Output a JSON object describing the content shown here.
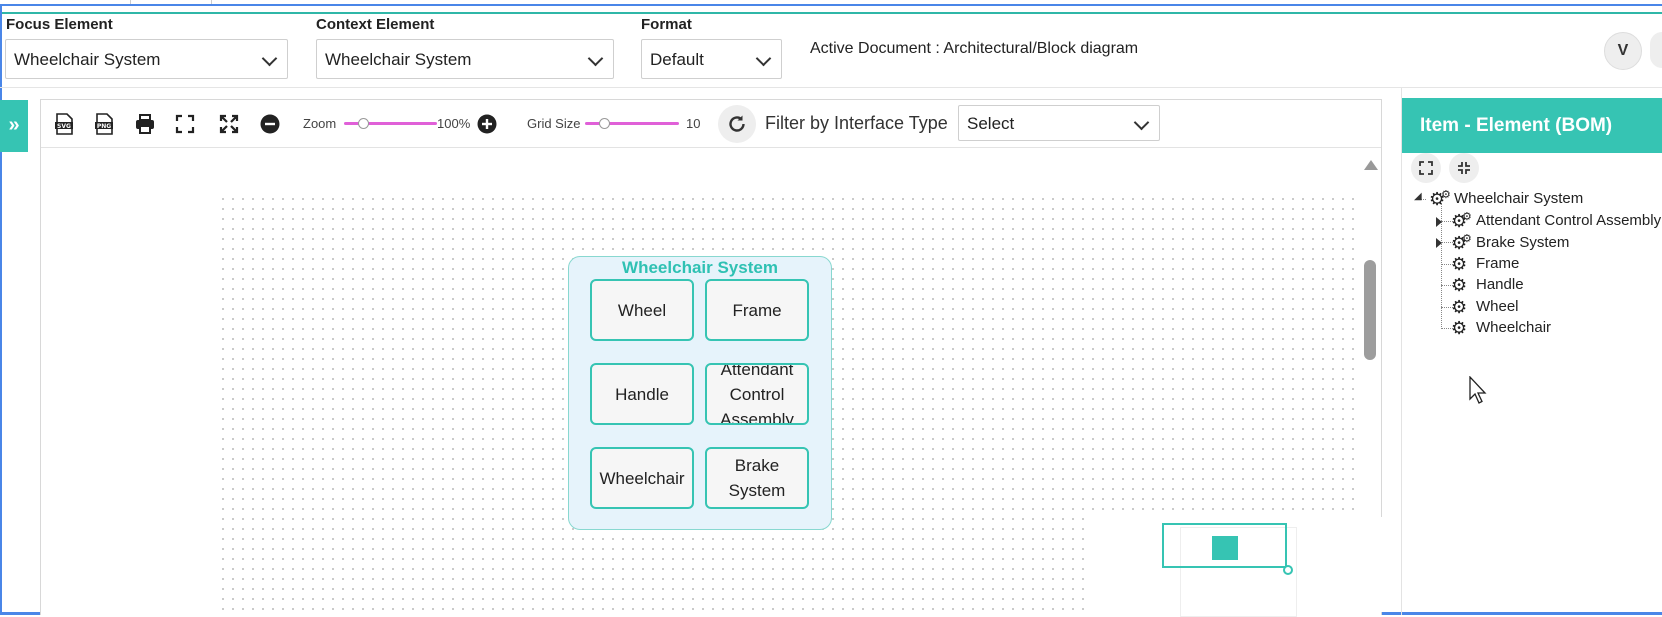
{
  "header": {
    "focus_label": "Focus Element",
    "focus_value": "Wheelchair System",
    "context_label": "Context Element",
    "context_value": "Wheelchair System",
    "format_label": "Format",
    "format_value": "Default",
    "active_document": "Active Document : Architectural/Block diagram",
    "user_icon_text": "V"
  },
  "toolbar": {
    "svg_label": "SVG",
    "png_label": "PNG",
    "zoom_label": "Zoom",
    "zoom_value": "100%",
    "zoom_level": 0.2,
    "grid_label": "Grid Size",
    "grid_value": "10",
    "grid_level": 0.2,
    "filter_label": "Filter by Interface Type",
    "filter_value": "Select"
  },
  "diagram": {
    "system_title": "Wheelchair System",
    "nodes": [
      "Wheel",
      "Frame",
      "Handle",
      "Attendant Control Assembly",
      "Wheelchair",
      "Brake System"
    ]
  },
  "right_panel": {
    "title": "Item - Element (BOM)",
    "tree": {
      "root": "Wheelchair System",
      "children": [
        "Attendant Control Assembly",
        "Brake System",
        "Frame",
        "Handle",
        "Wheel",
        "Wheelchair"
      ]
    }
  },
  "colors": {
    "accent": "#36c4b3",
    "slider": "#e060d8",
    "container_bg": "#e6f3fb",
    "frame_blue": "#4a86e8"
  },
  "icons": [
    "svg-export-icon",
    "png-export-icon",
    "print-icon",
    "fit-screen-icon",
    "expand-icon",
    "zoom-out-icon",
    "zoom-in-icon",
    "refresh-icon",
    "gear-icon",
    "chevron-down-icon",
    "double-chevron-right-icon"
  ]
}
